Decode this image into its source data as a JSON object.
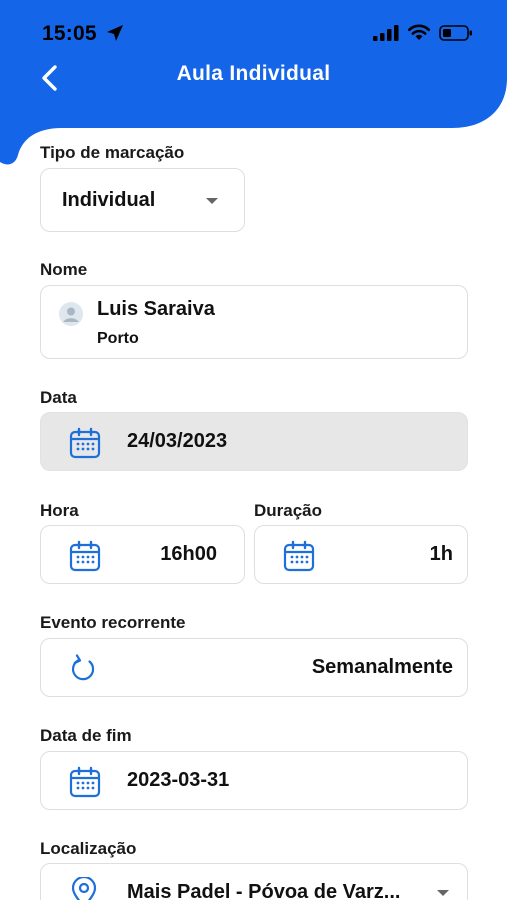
{
  "status_bar": {
    "time": "15:05"
  },
  "header": {
    "title": "Aula Individual"
  },
  "colors": {
    "primary": "#1565e8",
    "icon_blue": "#1e6fd9"
  },
  "form": {
    "booking_type": {
      "label": "Tipo de marcação",
      "value": "Individual"
    },
    "name": {
      "label": "Nome",
      "value": "Luis Saraiva",
      "subtitle": "Porto"
    },
    "date": {
      "label": "Data",
      "value": "24/03/2023"
    },
    "time": {
      "label": "Hora",
      "value": "16h00"
    },
    "duration": {
      "label": "Duração",
      "value": "1h"
    },
    "recurring": {
      "label": "Evento recorrente",
      "value": "Semanalmente"
    },
    "end_date": {
      "label": "Data de fim",
      "value": "2023-03-31"
    },
    "location": {
      "label": "Localização",
      "value": "Mais Padel - Póvoa de Varz..."
    }
  }
}
